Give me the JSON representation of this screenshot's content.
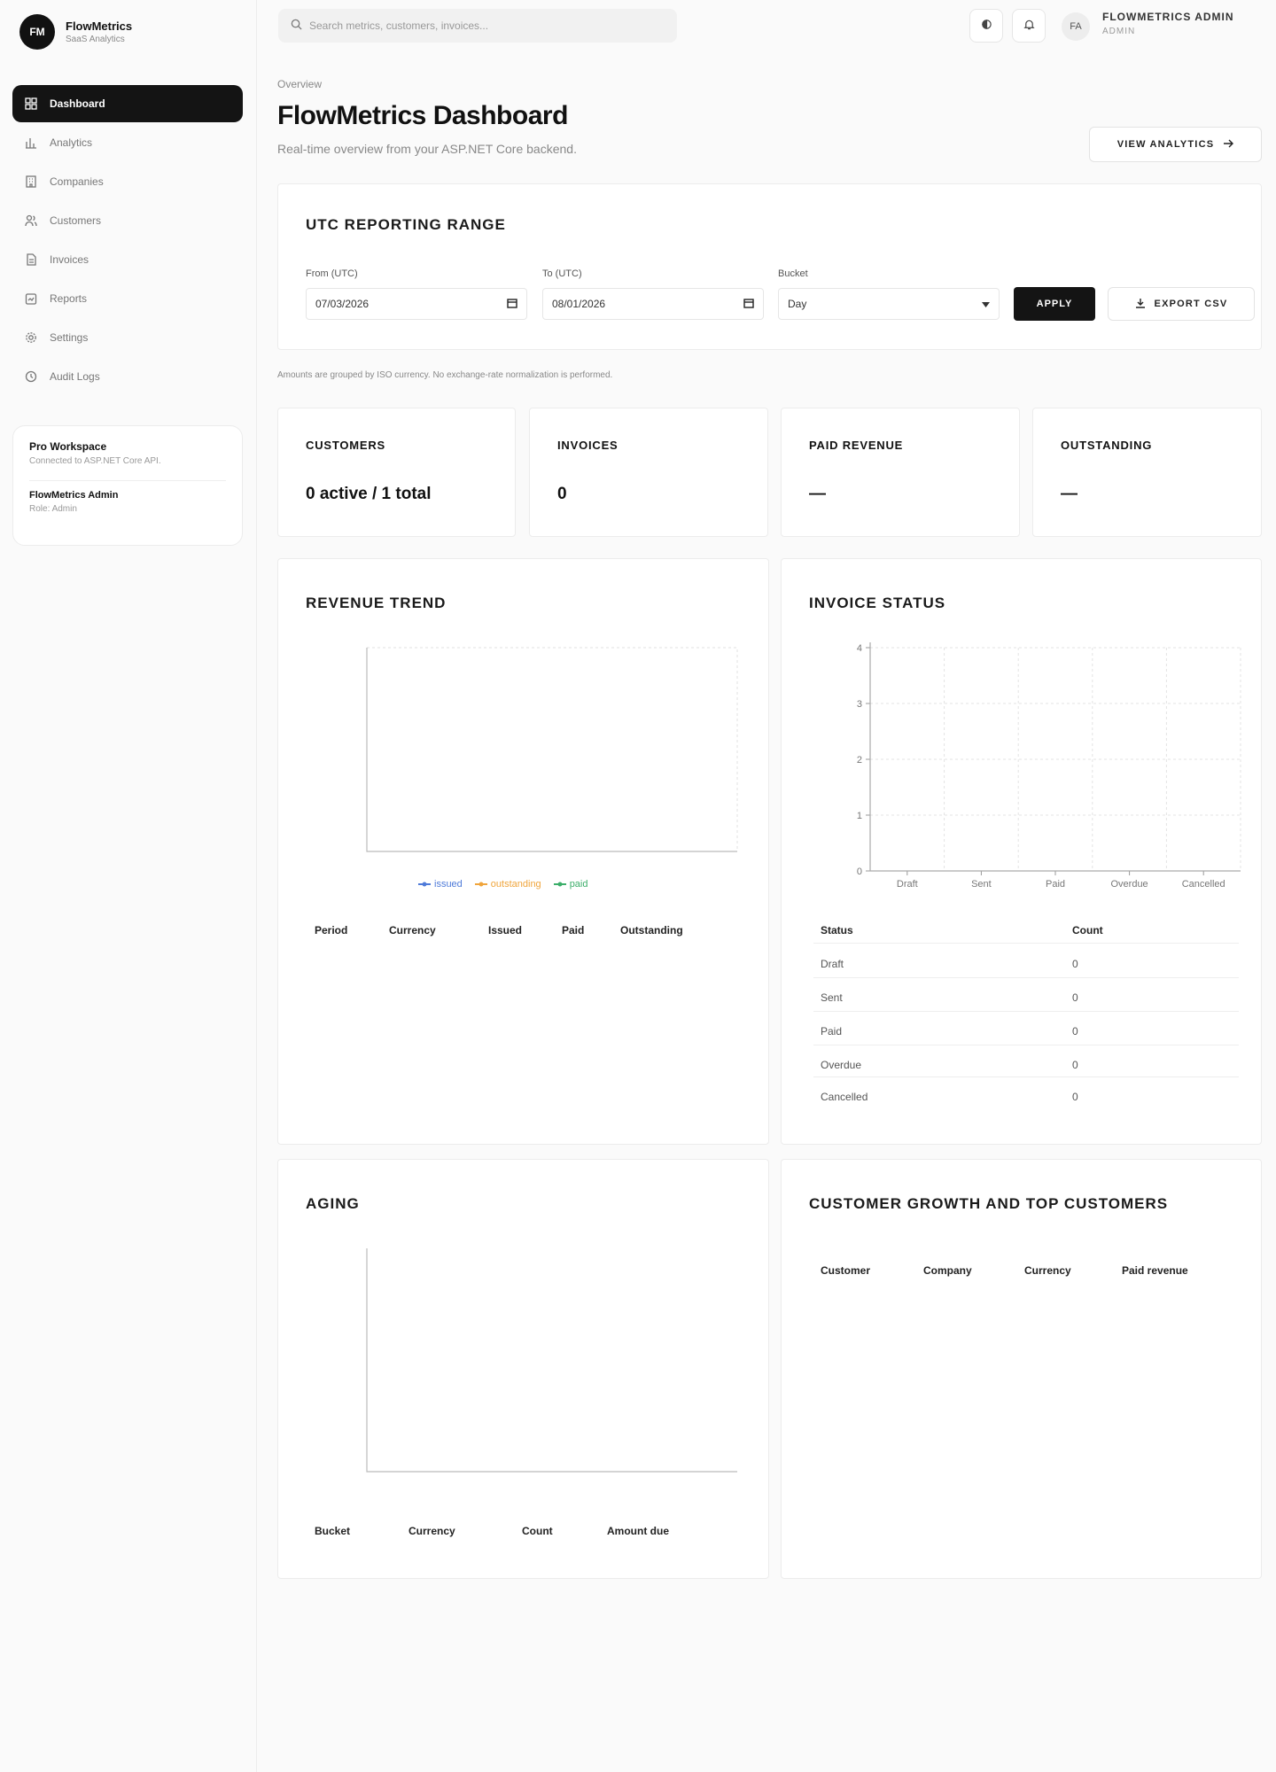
{
  "brand": {
    "initials": "FM",
    "name": "FlowMetrics",
    "subtitle": "SaaS Analytics"
  },
  "nav": [
    {
      "label": "Dashboard",
      "icon": "dashboard-icon",
      "active": true
    },
    {
      "label": "Analytics",
      "icon": "bar-chart-icon"
    },
    {
      "label": "Companies",
      "icon": "building-icon"
    },
    {
      "label": "Customers",
      "icon": "users-icon"
    },
    {
      "label": "Invoices",
      "icon": "file-icon"
    },
    {
      "label": "Reports",
      "icon": "report-icon"
    },
    {
      "label": "Settings",
      "icon": "gear-icon"
    },
    {
      "label": "Audit Logs",
      "icon": "clock-icon"
    }
  ],
  "workspace": {
    "title": "Pro Workspace",
    "subtitle": "Connected to ASP.NET Core API.",
    "user": "FlowMetrics Admin",
    "role": "Role: Admin"
  },
  "topbar": {
    "search_placeholder": "Search metrics, customers, invoices...",
    "avatar_initials": "FA",
    "user_name": "FLOWMETRICS ADMIN",
    "user_role": "ADMIN"
  },
  "header": {
    "breadcrumb": "Overview",
    "title": "FlowMetrics Dashboard",
    "subtitle": "Real-time overview from your ASP.NET Core backend.",
    "view_analytics": "VIEW ANALYTICS"
  },
  "range": {
    "title": "UTC REPORTING RANGE",
    "from_label": "From (UTC)",
    "from_value": "07/03/2026",
    "to_label": "To (UTC)",
    "to_value": "08/01/2026",
    "bucket_label": "Bucket",
    "bucket_value": "Day",
    "apply": "APPLY",
    "export": "EXPORT CSV"
  },
  "note": "Amounts are grouped by ISO currency. No exchange-rate normalization is performed.",
  "stats": [
    {
      "label": "CUSTOMERS",
      "value": "0 active / 1 total"
    },
    {
      "label": "INVOICES",
      "value": "0"
    },
    {
      "label": "PAID REVENUE",
      "value": "—"
    },
    {
      "label": "OUTSTANDING",
      "value": "—"
    }
  ],
  "revenue": {
    "title": "REVENUE TREND",
    "legend": [
      {
        "name": "issued",
        "color": "#4f7bd9"
      },
      {
        "name": "outstanding",
        "color": "#f0a53c"
      },
      {
        "name": "paid",
        "color": "#3cae6a"
      }
    ],
    "columns": [
      "Period",
      "Currency",
      "Issued",
      "Paid",
      "Outstanding"
    ]
  },
  "invoice_status": {
    "title": "INVOICE STATUS",
    "columns": [
      "Status",
      "Count"
    ],
    "rows": [
      {
        "status": "Draft",
        "count": "0"
      },
      {
        "status": "Sent",
        "count": "0"
      },
      {
        "status": "Paid",
        "count": "0"
      },
      {
        "status": "Overdue",
        "count": "0"
      },
      {
        "status": "Cancelled",
        "count": "0"
      }
    ]
  },
  "chart_data": {
    "type": "bar",
    "categories": [
      "Draft",
      "Sent",
      "Paid",
      "Overdue",
      "Cancelled"
    ],
    "values": [
      0,
      0,
      0,
      0,
      0
    ],
    "yticks": [
      "0",
      "1",
      "2",
      "3",
      "4"
    ],
    "ylim": [
      0,
      4
    ],
    "title": "",
    "grid": true
  },
  "aging": {
    "title": "AGING",
    "columns": [
      "Bucket",
      "Currency",
      "Count",
      "Amount due"
    ]
  },
  "growth": {
    "title": "CUSTOMER GROWTH AND TOP CUSTOMERS",
    "columns": [
      "Customer",
      "Company",
      "Currency",
      "Paid revenue"
    ]
  }
}
